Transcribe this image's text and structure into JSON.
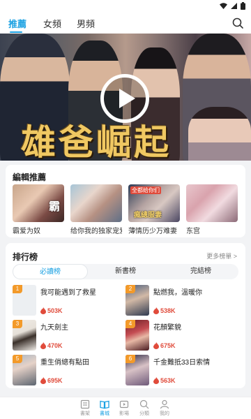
{
  "status_bar": {
    "wifi_icon": "wifi-icon",
    "signal_icon": "signal-icon",
    "battery_icon": "battery-icon"
  },
  "top_tabs": [
    {
      "label": "推薦",
      "active": true
    },
    {
      "label": "女頻",
      "active": false
    },
    {
      "label": "男頻",
      "active": false
    }
  ],
  "banner": {
    "title": "雄爸崛起",
    "play_icon": "play-icon"
  },
  "editor_picks": {
    "title": "編輯推薦",
    "items": [
      {
        "title": "霸爱为奴",
        "cover_text": "霸"
      },
      {
        "title": "给你我的独家宠爱",
        "cover_text": ""
      },
      {
        "title": "薄情历少万难妻",
        "cover_tag": "全都给你们",
        "cover_text": "瘋總服妻"
      },
      {
        "title": "东宫",
        "cover_text": ""
      }
    ]
  },
  "ranking": {
    "title": "排行榜",
    "more_label": "更多榜單 >",
    "tabs": [
      {
        "label": "必讀榜",
        "active": true
      },
      {
        "label": "新書榜",
        "active": false
      },
      {
        "label": "完結榜",
        "active": false
      }
    ],
    "items": [
      {
        "rank": "1",
        "title": "我可能遇到了救星",
        "heat": "503K"
      },
      {
        "rank": "2",
        "title": "點燃我，溫暖你",
        "heat": "538K"
      },
      {
        "rank": "3",
        "title": "九天劍主",
        "heat": "470K"
      },
      {
        "rank": "4",
        "title": "花顏繁貌",
        "heat": "675K"
      },
      {
        "rank": "5",
        "title": "重生俏總有點田",
        "heat": "695K"
      },
      {
        "rank": "6",
        "title": "千金難抵33日索情",
        "heat": "563K"
      }
    ]
  },
  "bottom_nav": [
    {
      "label": "書架",
      "icon": "bookshelf-icon",
      "active": false
    },
    {
      "label": "書城",
      "icon": "book-open-icon",
      "active": true
    },
    {
      "label": "影場",
      "icon": "video-icon",
      "active": false
    },
    {
      "label": "分類",
      "icon": "search-icon",
      "active": false
    },
    {
      "label": "我的",
      "icon": "user-icon",
      "active": false
    }
  ],
  "colors": {
    "accent": "#1ba1e2",
    "heat": "#e04b3b",
    "banner_title": "#f0c862"
  }
}
